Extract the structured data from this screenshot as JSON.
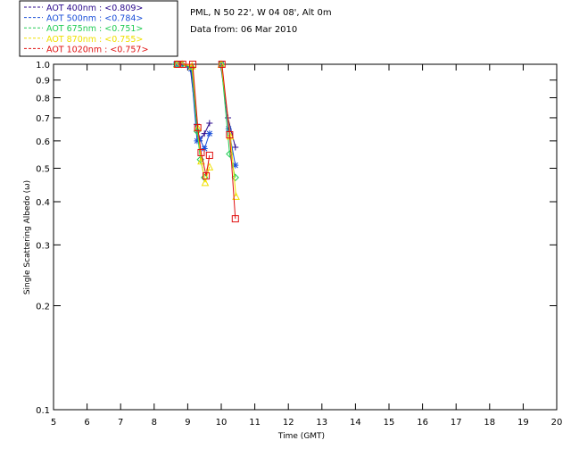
{
  "header": {
    "site": "PML, N 50 22', W 04 08', Alt 0m",
    "date_line": "Data from: 06 Mar 2010"
  },
  "chart_data": {
    "type": "line",
    "xlabel": "Time (GMT)",
    "ylabel": "Single Scattering Albedo (ω)",
    "xlim": [
      5,
      20
    ],
    "ylim": [
      0.1,
      1.0
    ],
    "yscale": "log",
    "x_ticks": [
      "5",
      "6",
      "7",
      "8",
      "9",
      "10",
      "11",
      "12",
      "13",
      "14",
      "15",
      "16",
      "17",
      "18",
      "19",
      "20"
    ],
    "y_ticks": [
      "0.1",
      "0.2",
      "0.3",
      "0.4",
      "0.5",
      "0.6",
      "0.7",
      "0.8",
      "0.9",
      "1.0"
    ],
    "legend_position": "top-left",
    "series": [
      {
        "name": "AOT  400nm : <0.809>",
        "color": "#2b0a8c",
        "marker": "plus",
        "segments": [
          [
            [
              8.62,
              1.0
            ],
            [
              8.8,
              1.0
            ],
            [
              9.08,
              0.97
            ],
            [
              9.27,
              0.67
            ],
            [
              9.35,
              0.6
            ],
            [
              9.5,
              0.63
            ],
            [
              9.65,
              0.675
            ]
          ],
          [
            [
              9.98,
              1.0
            ],
            [
              10.2,
              0.7
            ],
            [
              10.42,
              0.575
            ]
          ]
        ]
      },
      {
        "name": "AOT  500nm : <0.784>",
        "color": "#1a4fd8",
        "marker": "asterisk",
        "segments": [
          [
            [
              8.65,
              1.0
            ],
            [
              8.8,
              1.0
            ],
            [
              9.1,
              0.97
            ],
            [
              9.28,
              0.6
            ],
            [
              9.35,
              0.61
            ],
            [
              9.5,
              0.57
            ],
            [
              9.65,
              0.63
            ]
          ],
          [
            [
              10.0,
              1.0
            ],
            [
              10.22,
              0.65
            ],
            [
              10.42,
              0.51
            ]
          ]
        ]
      },
      {
        "name": "AOT  675nm : <0.751>",
        "color": "#22cc55",
        "marker": "diamond",
        "segments": [
          [
            [
              8.66,
              1.0
            ],
            [
              8.82,
              1.0
            ],
            [
              9.12,
              0.98
            ],
            [
              9.28,
              0.64
            ],
            [
              9.38,
              0.53
            ],
            [
              9.5,
              0.47
            ]
          ],
          [
            [
              10.0,
              1.0
            ],
            [
              10.25,
              0.55
            ],
            [
              10.42,
              0.47
            ]
          ]
        ]
      },
      {
        "name": "AOT  870nm : <0.755>",
        "color": "#f0e000",
        "marker": "triangle",
        "segments": [
          [
            [
              8.68,
              1.0
            ],
            [
              8.84,
              1.0
            ],
            [
              9.13,
              0.99
            ],
            [
              9.3,
              0.655
            ],
            [
              9.4,
              0.525
            ],
            [
              9.52,
              0.455
            ],
            [
              9.65,
              0.505
            ]
          ],
          [
            [
              10.0,
              1.0
            ],
            [
              10.27,
              0.62
            ],
            [
              10.44,
              0.415
            ]
          ]
        ]
      },
      {
        "name": "AOT 1020nm : <0.757>",
        "color": "#e01010",
        "marker": "square",
        "segments": [
          [
            [
              8.7,
              1.0
            ],
            [
              8.85,
              1.0
            ],
            [
              9.15,
              1.0
            ],
            [
              9.3,
              0.655
            ],
            [
              9.4,
              0.555
            ],
            [
              9.55,
              0.475
            ],
            [
              9.65,
              0.545
            ]
          ],
          [
            [
              10.02,
              1.0
            ],
            [
              10.25,
              0.625
            ],
            [
              10.42,
              0.357
            ]
          ]
        ]
      }
    ]
  }
}
